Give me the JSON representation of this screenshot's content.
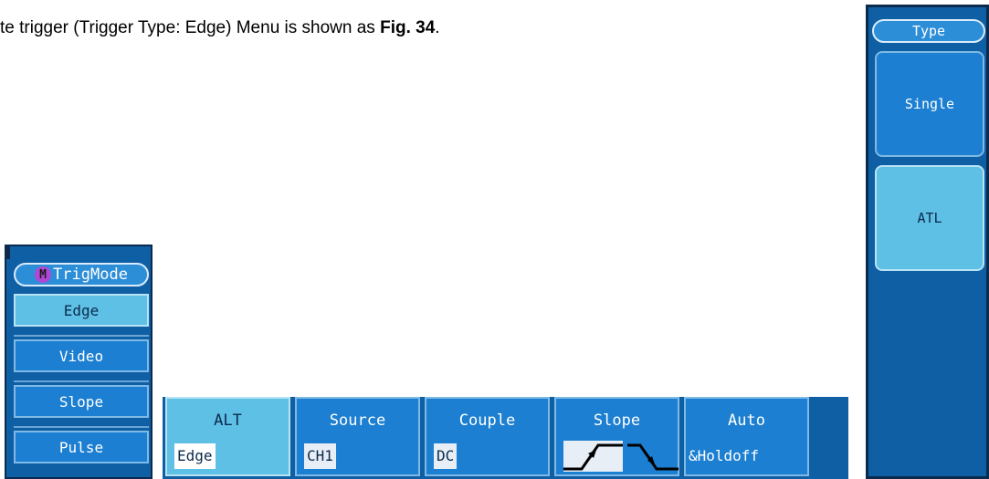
{
  "caption": {
    "prefix": "te trigger (Trigger Type: Edge) Menu is shown as ",
    "figure": "Fig. 34",
    "suffix": "."
  },
  "trigmode_menu": {
    "header_badge": "M",
    "header_label": "TrigMode",
    "items": [
      {
        "label": "Edge",
        "selected": true
      },
      {
        "label": "Video",
        "selected": false
      },
      {
        "label": "Slope",
        "selected": false
      },
      {
        "label": "Pulse",
        "selected": false
      }
    ]
  },
  "bottom_menu": {
    "buttons": [
      {
        "title": "ALT",
        "value": "Edge",
        "selected": true
      },
      {
        "title": "Source",
        "value": "CH1",
        "selected": false
      },
      {
        "title": "Couple",
        "value": "DC",
        "selected": false
      },
      {
        "title": "Slope",
        "value": "",
        "selected": false,
        "icons": [
          "rising-edge-icon",
          "falling-edge-icon"
        ]
      },
      {
        "title": "Auto",
        "value": "&Holdoff",
        "selected": false
      }
    ]
  },
  "type_menu": {
    "header_label": "Type",
    "items": [
      {
        "label": "Single",
        "selected": false
      },
      {
        "label": "ATL",
        "selected": true
      }
    ]
  },
  "colors": {
    "panel": "#0f5fa5",
    "button": "#1c7fd1",
    "selected": "#5fc0e6",
    "border_dark": "#0b2a4c",
    "badge": "#b048d6"
  }
}
